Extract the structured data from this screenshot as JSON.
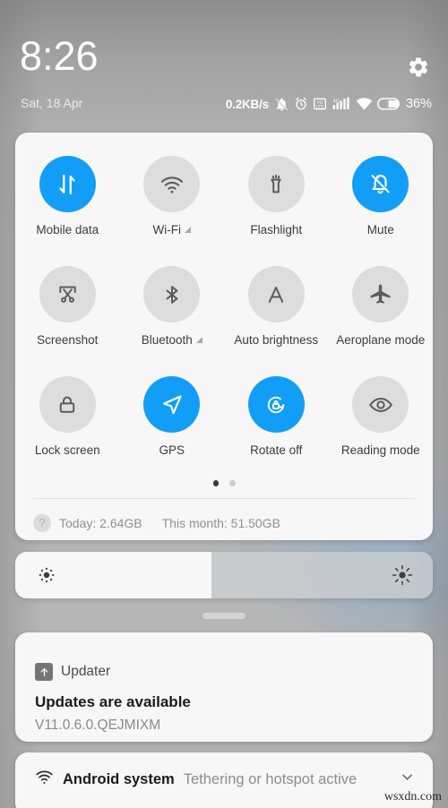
{
  "status_bar": {
    "time": "8:26",
    "date": "Sat, 18 Apr",
    "network_speed": "0.2KB/s",
    "battery_percent": "36%",
    "icons": [
      "mute-bell-icon",
      "alarm-clock-icon",
      "volte-icon",
      "signal-4g-icon",
      "wifi-icon",
      "battery-icon"
    ],
    "settings_icon": "gear-icon",
    "accent_color": "#129ef7"
  },
  "quick_settings": {
    "rows": [
      [
        {
          "label": "Mobile data",
          "icon": "mobile-data-icon",
          "active": true,
          "has_arrow": false
        },
        {
          "label": "Wi-Fi",
          "icon": "wifi-icon",
          "active": false,
          "has_arrow": true
        },
        {
          "label": "Flashlight",
          "icon": "flashlight-icon",
          "active": false,
          "has_arrow": false
        },
        {
          "label": "Mute",
          "icon": "mute-bell-icon",
          "active": true,
          "has_arrow": false
        }
      ],
      [
        {
          "label": "Screenshot",
          "icon": "screenshot-icon",
          "active": false,
          "has_arrow": false
        },
        {
          "label": "Bluetooth",
          "icon": "bluetooth-icon",
          "active": false,
          "has_arrow": true
        },
        {
          "label": "Auto brightness",
          "icon": "auto-brightness-icon",
          "active": false,
          "has_arrow": false
        },
        {
          "label": "Aeroplane mode",
          "icon": "aeroplane-icon",
          "active": false,
          "has_arrow": false
        }
      ],
      [
        {
          "label": "Lock screen",
          "icon": "lock-icon",
          "active": false,
          "has_arrow": false
        },
        {
          "label": "GPS",
          "icon": "navigation-icon",
          "active": true,
          "has_arrow": false
        },
        {
          "label": "Rotate off",
          "icon": "rotate-lock-icon",
          "active": true,
          "has_arrow": false
        },
        {
          "label": "Reading mode",
          "icon": "eye-icon",
          "active": false,
          "has_arrow": false
        }
      ]
    ],
    "pager": {
      "pages": 2,
      "current": 1
    },
    "data_usage": {
      "help_icon": "question-mark-icon",
      "today": "Today: 2.64GB",
      "month": "This month: 51.50GB"
    }
  },
  "brightness": {
    "level_percent": 47,
    "low_icon": "brightness-low-icon",
    "high_icon": "brightness-high-icon"
  },
  "notifications": [
    {
      "app": "Updater",
      "app_icon": "update-arrow-icon",
      "title": "Updates are available",
      "body": "V11.0.6.0.QEJMIXM"
    },
    {
      "app": "Android system",
      "app_icon": "wifi-tether-icon",
      "title": "Tethering or hotspot active",
      "expand_icon": "chevron-down-icon"
    }
  ],
  "watermark": "wsxdn.com"
}
